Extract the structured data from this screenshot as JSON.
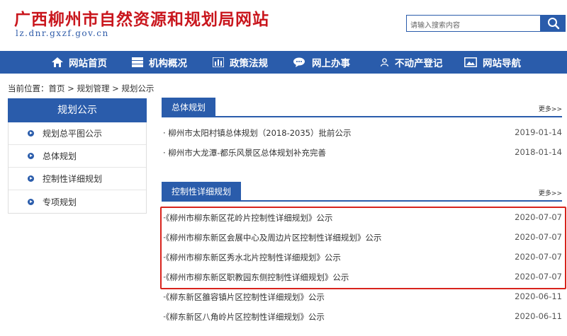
{
  "header": {
    "title": "广西柳州市自然资源和规划局网站",
    "url": "lz.dnr.gxzf.gov.cn",
    "search_placeholder": "请输入搜索内容"
  },
  "nav": {
    "items": [
      {
        "label": "网站首页",
        "icon": "home-icon"
      },
      {
        "label": "机构概况",
        "icon": "building-icon"
      },
      {
        "label": "政策法规",
        "icon": "bar-chart-icon"
      },
      {
        "label": "网上办事",
        "icon": "chat-icon"
      },
      {
        "label": "不动产登记",
        "icon": "user-icon"
      },
      {
        "label": "网站导航",
        "icon": "image-icon"
      }
    ]
  },
  "breadcrumb": "当前位置：首页 > 规划管理 > 规划公示",
  "sidebar": {
    "title": "规划公示",
    "items": [
      {
        "label": "规划总平图公示"
      },
      {
        "label": "总体规划"
      },
      {
        "label": "控制性详细规划"
      },
      {
        "label": "专项规划"
      }
    ]
  },
  "sections": [
    {
      "title": "总体规划",
      "more": "更多>>",
      "rows": [
        {
          "title": "· 柳州市太阳村镇总体规划（2018-2035）批前公示",
          "date": "2019-01-14"
        },
        {
          "title": "· 柳州市大龙潭-都乐风景区总体规划补充完善",
          "date": "2018-01-14"
        }
      ]
    },
    {
      "title": "控制性详细规划",
      "more": "更多>>",
      "rows": [
        {
          "title": "·《柳州市柳东新区花岭片控制性详细规划》公示",
          "date": "2020-07-07"
        },
        {
          "title": "·《柳州市柳东新区会展中心及周边片区控制性详细规划》公示",
          "date": "2020-07-07"
        },
        {
          "title": "·《柳州市柳东新区秀水北片控制性详细规划》公示",
          "date": "2020-07-07"
        },
        {
          "title": "·《柳州市柳东新区职教园东侧控制性详细规划》公示",
          "date": "2020-07-07"
        },
        {
          "title": "·《柳东新区雒容镇片区控制性详细规划》公示",
          "date": "2020-06-11"
        },
        {
          "title": "·《柳东新区八角岭片区控制性详细规划》公示",
          "date": "2020-06-11"
        }
      ]
    }
  ],
  "colors": {
    "brand_blue": "#2a5cab",
    "title_red": "#c9161d",
    "highlight_red": "#d8231c"
  }
}
